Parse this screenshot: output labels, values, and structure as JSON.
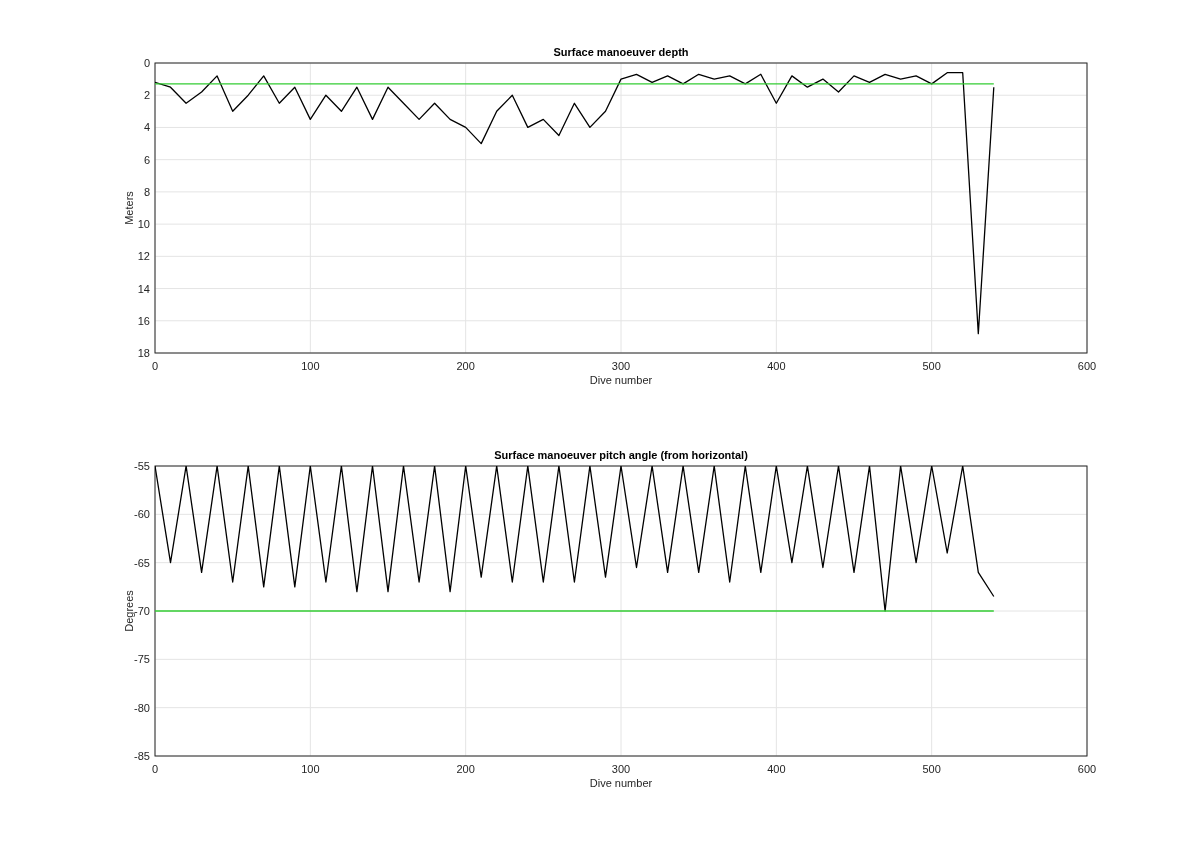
{
  "axes": [
    {
      "chart_data": {
        "type": "line",
        "grid": true,
        "title": "Surface manoeuver depth",
        "xlabel": "Dive number",
        "ylabel": "Meters",
        "xlim": [
          0,
          600
        ],
        "ylim": [
          18,
          0
        ],
        "xticks": [
          0,
          100,
          200,
          300,
          400,
          500,
          600
        ],
        "yticks": [
          0,
          2,
          4,
          6,
          8,
          10,
          12,
          14,
          16,
          18
        ],
        "x": [
          0,
          10,
          20,
          30,
          40,
          50,
          60,
          70,
          80,
          90,
          100,
          110,
          120,
          130,
          140,
          150,
          160,
          170,
          180,
          190,
          200,
          210,
          220,
          230,
          240,
          250,
          260,
          270,
          280,
          290,
          300,
          310,
          320,
          330,
          340,
          350,
          360,
          370,
          380,
          390,
          400,
          410,
          420,
          430,
          440,
          450,
          460,
          470,
          480,
          490,
          500,
          510,
          520,
          530,
          540
        ],
        "series": [
          {
            "color": "#000000",
            "values": [
              1.2,
              1.5,
              2.5,
              1.8,
              0.8,
              3,
              2,
              0.8,
              2.5,
              1.5,
              3.5,
              2,
              3,
              1.5,
              3.5,
              1.5,
              2.5,
              3.5,
              2.5,
              3.5,
              4,
              5,
              3,
              2,
              4,
              3.5,
              4.5,
              2.5,
              4,
              3,
              1,
              0.7,
              1.2,
              0.8,
              1.3,
              0.7,
              1,
              0.8,
              1.3,
              0.7,
              2.5,
              0.8,
              1.5,
              1,
              1.8,
              0.8,
              1.2,
              0.7,
              1,
              0.8,
              1.3,
              0.6,
              0.6,
              16.8,
              1.5
            ]
          },
          {
            "color": "#33cc33",
            "values": [
              1.3,
              1.3,
              1.3,
              1.3,
              1.3,
              1.3,
              1.3,
              1.3,
              1.3,
              1.3,
              1.3,
              1.3,
              1.3,
              1.3,
              1.3,
              1.3,
              1.3,
              1.3,
              1.3,
              1.3,
              1.3,
              1.3,
              1.3,
              1.3,
              1.3,
              1.3,
              1.3,
              1.3,
              1.3,
              1.3,
              1.3,
              1.3,
              1.3,
              1.3,
              1.3,
              1.3,
              1.3,
              1.3,
              1.3,
              1.3,
              1.3,
              1.3,
              1.3,
              1.3,
              1.3,
              1.3,
              1.3,
              1.3,
              1.3,
              1.3,
              1.3,
              1.3,
              1.3,
              1.3,
              1.3
            ]
          }
        ]
      }
    },
    {
      "chart_data": {
        "type": "line",
        "grid": true,
        "title": "Surface manoeuver pitch angle (from horizontal)",
        "xlabel": "Dive number",
        "ylabel": "Degrees",
        "xlim": [
          0,
          600
        ],
        "ylim": [
          -85,
          -55
        ],
        "xticks": [
          0,
          100,
          200,
          300,
          400,
          500,
          600
        ],
        "yticks": [
          -85,
          -80,
          -75,
          -70,
          -65,
          -60,
          -55
        ],
        "x": [
          0,
          10,
          20,
          30,
          40,
          50,
          60,
          70,
          80,
          90,
          100,
          110,
          120,
          130,
          140,
          150,
          160,
          170,
          180,
          190,
          200,
          210,
          220,
          230,
          240,
          250,
          260,
          270,
          280,
          290,
          300,
          310,
          320,
          330,
          340,
          350,
          360,
          370,
          380,
          390,
          400,
          410,
          420,
          430,
          440,
          450,
          460,
          470,
          480,
          490,
          500,
          510,
          520,
          530,
          540
        ],
        "series": [
          {
            "color": "#000000",
            "values": [
              -55,
              -65,
              -55,
              -66,
              -55,
              -67,
              -55,
              -67.5,
              -55,
              -67.5,
              -55,
              -67,
              -55,
              -68,
              -55,
              -68,
              -55,
              -67,
              -55,
              -68,
              -55,
              -66.5,
              -55,
              -67,
              -55,
              -67,
              -55,
              -67,
              -55,
              -66.5,
              -55,
              -65.5,
              -55,
              -66,
              -55,
              -66,
              -55,
              -67,
              -55,
              -66,
              -55,
              -65,
              -55,
              -65.5,
              -55,
              -66,
              -55,
              -70,
              -55,
              -65,
              -55,
              -64,
              -55,
              -66,
              -68.5
            ]
          },
          {
            "color": "#33cc33",
            "values": [
              -70,
              -70,
              -70,
              -70,
              -70,
              -70,
              -70,
              -70,
              -70,
              -70,
              -70,
              -70,
              -70,
              -70,
              -70,
              -70,
              -70,
              -70,
              -70,
              -70,
              -70,
              -70,
              -70,
              -70,
              -70,
              -70,
              -70,
              -70,
              -70,
              -70,
              -70,
              -70,
              -70,
              -70,
              -70,
              -70,
              -70,
              -70,
              -70,
              -70,
              -70,
              -70,
              -70,
              -70,
              -70,
              -70,
              -70,
              -70,
              -70,
              -70,
              -70,
              -70,
              -70,
              -70,
              -70
            ]
          }
        ]
      }
    }
  ]
}
